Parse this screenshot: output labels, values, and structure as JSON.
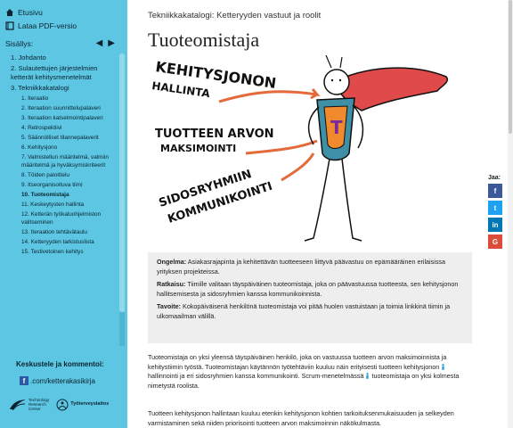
{
  "sidebar": {
    "home": "Etusivu",
    "pdf": "Lataa PDF-versio",
    "toc_title": "Sisällys:",
    "toc": [
      {
        "level": 1,
        "label": "1. Johdanto"
      },
      {
        "level": 1,
        "label": "2. Sulautettujen järjestelmien ketterät kehitysmenetelmät"
      },
      {
        "level": 1,
        "label": "3. Tekniikkakatalogi"
      },
      {
        "level": 2,
        "label": "1. Iteraatio"
      },
      {
        "level": 2,
        "label": "2. Iteraation suunnittelupalaveri"
      },
      {
        "level": 2,
        "label": "3. Iteraation katselmointipalaveri"
      },
      {
        "level": 2,
        "label": "4. Retrospektiivi"
      },
      {
        "level": 2,
        "label": "5. Säännölliset tilannepalaverit"
      },
      {
        "level": 2,
        "label": "6. Kehitysjono"
      },
      {
        "level": 2,
        "label": "7. Valmistellun määritelmä, valmiin määritelmä ja hyväksymiskriteerit"
      },
      {
        "level": 2,
        "label": "8. Töiden paloittelu"
      },
      {
        "level": 2,
        "label": "9. Itseorganisoituva tiimi"
      },
      {
        "level": 2,
        "label": "10. Tuoteomistaja",
        "active": true
      },
      {
        "level": 2,
        "label": "11. Keskeytysten hallinta"
      },
      {
        "level": 2,
        "label": "12. Ketterän työkaluohjelmiston valitseminen"
      },
      {
        "level": 2,
        "label": "13. Iteraation tehtävätaulu"
      },
      {
        "level": 2,
        "label": "14. Ketteryyden tarkistuslista"
      },
      {
        "level": 2,
        "label": "15. Testivetoinen kehitys"
      }
    ],
    "comment_title": "Keskustele ja kommentoi:",
    "facebook": ".com/ketterakasikirja",
    "logo1": [
      "Technology",
      "Research",
      "Center"
    ],
    "logo2": "Työterveyslaitos"
  },
  "main": {
    "breadcrumb": "Tekniikkakatalogi: Ketteryyden vastuut ja roolit",
    "title": "Tuoteomistaja",
    "illustration": {
      "text1a": "KEHITYSJONON",
      "text1b": "HALLINTA",
      "text2a": "TUOTTEEN ARVON",
      "text2b": "MAKSIMOINTI",
      "text3a": "SIDOSRYHMIIN",
      "text3b": "KOMMUNIKOINTI",
      "emblem": "T"
    },
    "box": {
      "problem_label": "Ongelma:",
      "problem": " Asiakasrajapinta ja kehitettävän tuotteeseen liittyvä päävastuu on epämääräinen erilaisissa yrityksen projekteissa.",
      "solution_label": "Ratkaisu:",
      "solution": " Tiimille valitaan täyspäiväinen tuoteomistaja, joka on päävastuussa tuotteesta, sen kehitysjonon hallitsemisesta ja sidosryhmien kanssa kommunikoinnista.",
      "goal_label": "Tavoite:",
      "goal": " Kokopäiväisenä henkilönä tuoteomistaja voi pitää huolen vastuistaan ja toimia linkkinä tiimin ja ulkomaailman välillä."
    },
    "para1_a": "Tuoteomistaja on yksi yleensä täyspäiväinen henkilö, joka on vastuussa tuotteen arvon maksimoinnista ja kehitystiimin työstä. Tuoteomistajan käytännön työtehtäviin kuuluu näin erityisesti tuotteen kehitysjonon ",
    "para1_b": " hallinnointi ja eri sidosryhmien kanssa kommunikointi. Scrum-menetelmässä ",
    "para1_c": " tuoteomistaja on yksi kolmesta nimetystä roolista.",
    "para2": "Tuotteen kehitysjonon hallintaan kuuluu etenkin kehitysjonon kohtien tarkoituksenmukaisuuden ja selkeyden varmistaminen sekä niiden priorisointi tuotteen arvon maksimoinnin näkökulmasta."
  },
  "share": {
    "label": "Jaa:",
    "buttons": [
      {
        "name": "facebook",
        "glyph": "f",
        "color": "#3b5998"
      },
      {
        "name": "twitter",
        "glyph": "t",
        "color": "#1da1f2"
      },
      {
        "name": "linkedin",
        "glyph": "in",
        "color": "#0077b5"
      },
      {
        "name": "googleplus",
        "glyph": "G",
        "color": "#dd4b39"
      }
    ]
  },
  "colors": {
    "sidebar": "#5cc6e3",
    "cape": "#e04a4a",
    "arrow": "#e46a3a"
  }
}
